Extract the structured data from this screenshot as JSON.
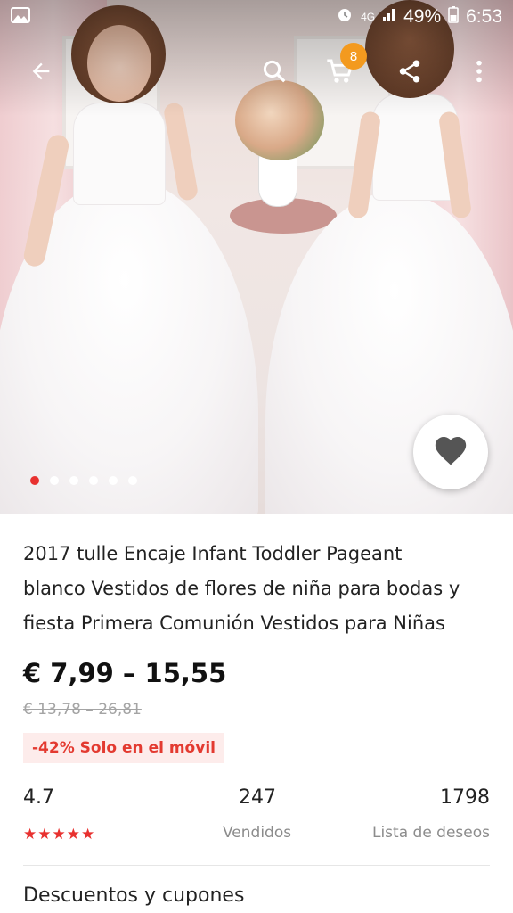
{
  "status_bar": {
    "network": "4G",
    "battery": "49%",
    "time": "6:53"
  },
  "toolbar": {
    "cart_count": "8"
  },
  "gallery": {
    "image_count": 6,
    "active_index": 0
  },
  "product": {
    "title_lines": [
      "2017 tulle Encaje Infant Toddler Pageant",
      "blanco Vestidos de flores de niña para bodas y",
      "fiesta Primera Comunión Vestidos para Niñas"
    ],
    "price": "€ 7,99 – 15,55",
    "original_price": "€ 13,78 – 26,81",
    "discount_tag": "-42% Solo en el móvil"
  },
  "stats": {
    "rating": "4.7",
    "rating_stars": 5,
    "sold_count": "247",
    "sold_label": "Vendidos",
    "wishlist_count": "1798",
    "wishlist_label": "Lista de deseos"
  },
  "sections": {
    "discounts_label": "Descuentos y cupones"
  },
  "colors": {
    "accent": "#e8312f",
    "badge": "#f39a1f"
  }
}
